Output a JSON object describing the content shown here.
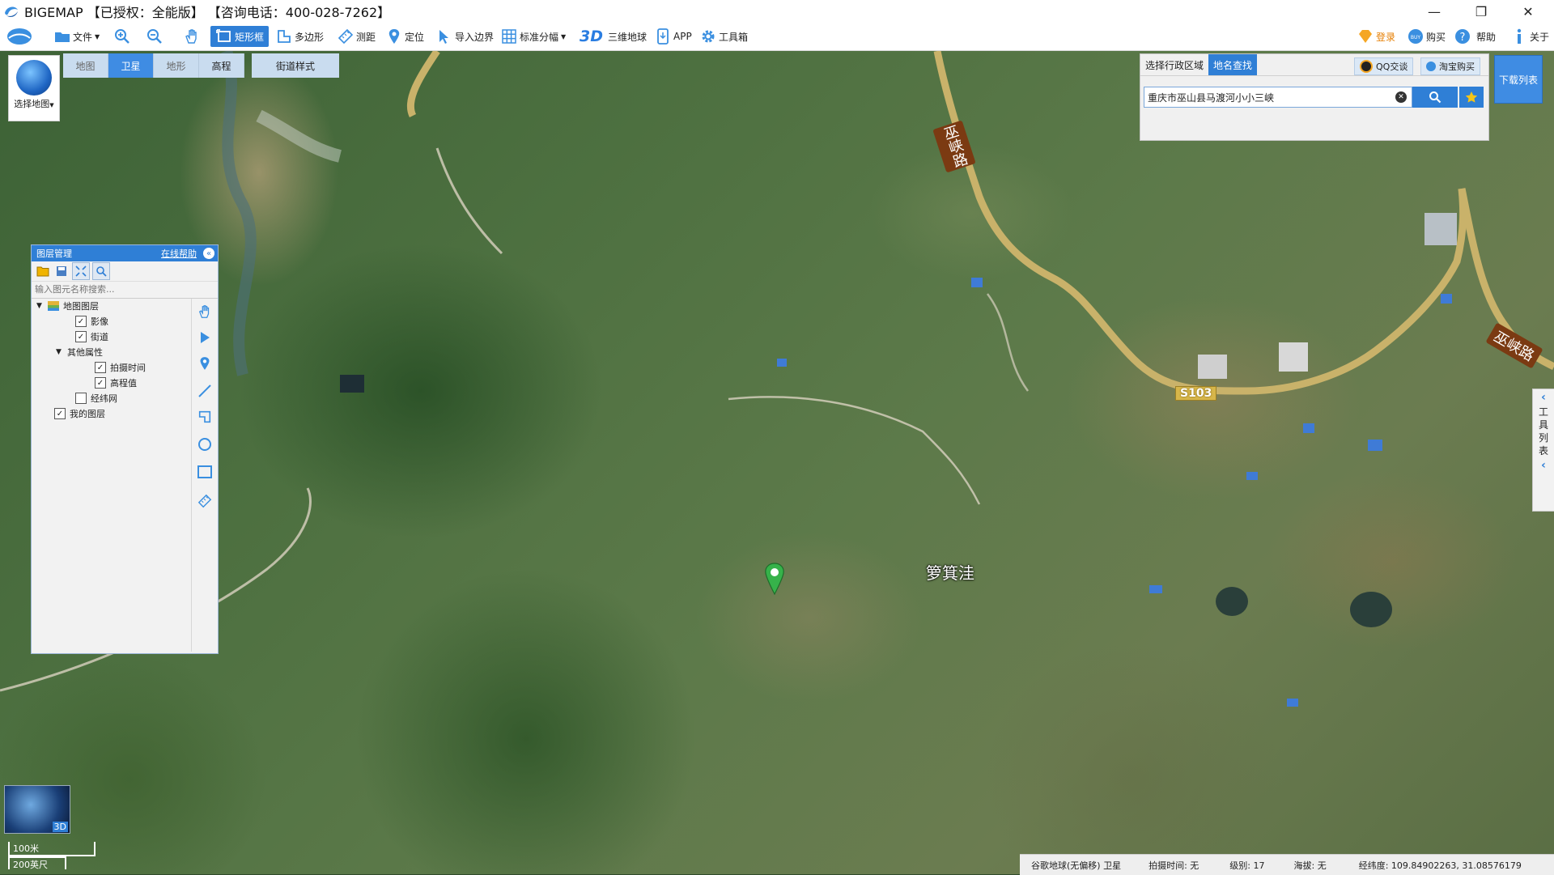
{
  "app": {
    "title": "BIGEMAP 【已授权：全能版】 【咨询电话：400-028-7262】"
  },
  "window_controls": {
    "minimize": "—",
    "restore": "❐",
    "close": "✕"
  },
  "toolbar": {
    "file": "文件",
    "rect": "矩形框",
    "polygon": "多边形",
    "measure": "测距",
    "locate": "定位",
    "import_border": "导入边界",
    "standard_tiles": "标准分幅",
    "three_d_badge": "3D",
    "three_d_globe": "三维地球",
    "app": "APP",
    "toolbox": "工具箱",
    "login": "登录",
    "buy": "购买",
    "help": "帮助",
    "about": "关于"
  },
  "map_types": {
    "select_map": "选择地图",
    "map": "地图",
    "satellite": "卫星",
    "terrain": "地形",
    "elevation": "高程",
    "street_style": "街道样式"
  },
  "layer_panel": {
    "title": "图层管理",
    "help": "在线帮助",
    "search_placeholder": "输入图元名称搜索...",
    "tree": {
      "map_layers": "地图图层",
      "imagery": "影像",
      "streets": "街道",
      "other_attrs": "其他属性",
      "capture_time": "拍摄时间",
      "elevation_value": "高程值",
      "graticule": "经纬网",
      "my_layers": "我的图层"
    }
  },
  "search_panel": {
    "tab_region": "选择行政区域",
    "tab_place": "地名查找",
    "qq": "QQ交谈",
    "taobao": "淘宝购买",
    "query": "重庆市巫山县马渡河小小三峡",
    "download_list": "下载列表"
  },
  "tool_list": {
    "label": [
      "工",
      "具",
      "列",
      "表"
    ]
  },
  "map_labels": {
    "place": "箩箕洼",
    "road_shield": "S103",
    "road_name_1": "巫峡路",
    "road_name_2": "巫峡路"
  },
  "mini3d": {
    "label": "3D"
  },
  "scale": {
    "metric": "100米",
    "imperial": "200英尺"
  },
  "status": {
    "source": "谷歌地球(无偏移) 卫星",
    "capture_time": "拍摄时间: 无",
    "level": "级别: 17",
    "altitude": "海拔: 无",
    "coords": "经纬度: 109.84902263, 31.08576179"
  }
}
